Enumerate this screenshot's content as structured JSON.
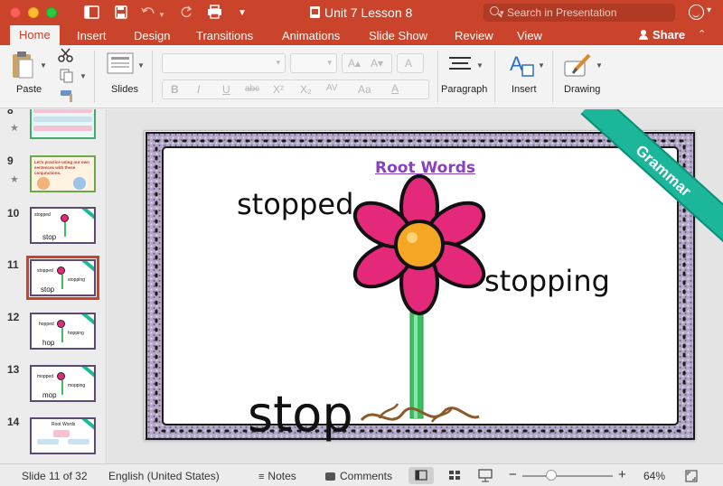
{
  "window": {
    "title": "Unit 7 Lesson 8",
    "search_placeholder": "Search in Presentation"
  },
  "tabs": [
    "Home",
    "Insert",
    "Design",
    "Transitions",
    "Animations",
    "Slide Show",
    "Review",
    "View"
  ],
  "share_label": "Share",
  "ribbon": {
    "paste": "Paste",
    "slides": "Slides",
    "paragraph": "Paragraph",
    "insert": "Insert",
    "drawing": "Drawing",
    "format_buttons": [
      "B",
      "I",
      "U",
      "abc",
      "X²",
      "X₂",
      "AV",
      "Aa",
      "A"
    ]
  },
  "thumbnails": [
    {
      "number": "8",
      "star": "★"
    },
    {
      "number": "9",
      "star": "★",
      "text": "Let's practice using our own sentences with these conjunctions."
    },
    {
      "number": "10",
      "words": [
        "stopped",
        "stop"
      ]
    },
    {
      "number": "11",
      "words": [
        "stopped",
        "stopping",
        "stop"
      ]
    },
    {
      "number": "12",
      "words": [
        "hopped",
        "hopping",
        "hop"
      ]
    },
    {
      "number": "13",
      "words": [
        "mopped",
        "mopping",
        "mop"
      ]
    },
    {
      "number": "14",
      "words": [
        "Root Words"
      ]
    }
  ],
  "slide": {
    "title": "Root Words",
    "word_past": "stopped",
    "word_ing": "stopping",
    "root": "stop",
    "banner": "Grammar",
    "colors": {
      "petal": "#e4287a",
      "center": "#f5a623",
      "stem": "#3cbf62",
      "title": "#8a3ec0",
      "banner": "#1cb79a"
    }
  },
  "status": {
    "slide_counter": "Slide 11 of 32",
    "language": "English (United States)",
    "notes": "Notes",
    "comments": "Comments",
    "zoom": "64%",
    "zoom_value": 0.64
  }
}
